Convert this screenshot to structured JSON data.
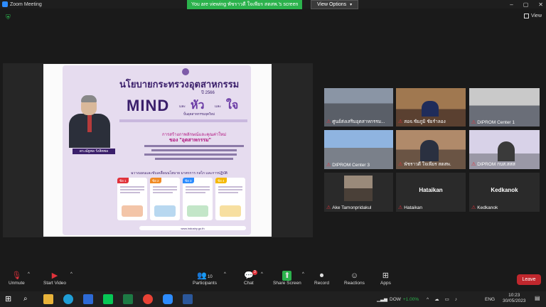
{
  "window": {
    "title": "Zoom Meeting",
    "viewing_banner": "You are viewing พัชราวดี ใจเพียร สตสพ.'s screen",
    "view_options": "View Options",
    "view_button": "View"
  },
  "poster": {
    "title": "นโยบายกระทรวงอุตสาหกรรม",
    "year": "ปี 2566",
    "mind": "MIND",
    "hua": "หัว",
    "and": "และ",
    "jai": "ใจ",
    "subtitle": "ปั้นอุตสาหกรรมยุคใหม่",
    "person_name": "ดร.ณัฐพล รังสิตพล",
    "heading_a": "การสร้างภาพลักษณ์และคุณค่าใหม่",
    "heading_b": "ของ \"อุตสาหกรรม\"",
    "mid_text": "ฉวางแผนและขับเคลื่อนนโยบาย มาตรการ กลไก และการปฏิบัติ",
    "cards": [
      {
        "tag": "ข้อ 1",
        "color": "#e0323b"
      },
      {
        "tag": "ข้อ 2",
        "color": "#f08a24"
      },
      {
        "tag": "ข้อ 3",
        "color": "#2d8cff"
      },
      {
        "tag": "ข้อ 4",
        "color": "#f5b800"
      }
    ],
    "footer": "www.industry.go.th"
  },
  "participants_grid": [
    {
      "label": "ศูนย์ส่งเสริมอุตสาหกรรม...",
      "muted": true
    },
    {
      "label": "สอจ.ชัยภูมิ ชัยรำลอง",
      "muted": true,
      "active": true
    },
    {
      "label": "DIPROM Center 1",
      "muted": true
    },
    {
      "label": "DIPROM Center 3",
      "muted": true
    },
    {
      "label": "พัชราวดี ใจเพียร สตสพ.",
      "muted": true
    },
    {
      "label": "DIPROM กบส.สสส",
      "muted": true
    },
    {
      "label": "Ake Tamonpridakul",
      "muted": true
    },
    {
      "label": "Hataikan",
      "muted": true,
      "name_only": "Hataikan"
    },
    {
      "label": "Kedkanok",
      "muted": true,
      "name_only": "Kedkanok"
    }
  ],
  "toolbar": {
    "unmute": "Unmute",
    "start_video": "Start Video",
    "participants": "Participants",
    "participants_count": "10",
    "chat": "Chat",
    "chat_badge": "3",
    "share_screen": "Share Screen",
    "record": "Record",
    "reactions": "Reactions",
    "apps": "Apps",
    "leave": "Leave"
  },
  "taskbar": {
    "stock": "DOW",
    "stock_change": "+1.00%",
    "lang": "ENG",
    "time": "10:23",
    "date": "30/05/2023"
  },
  "colors": {
    "accent_green": "#2bb24c",
    "leave_red": "#c0272d",
    "active_outline": "#a6e22e",
    "poster_purple": "#3b1f6b"
  }
}
